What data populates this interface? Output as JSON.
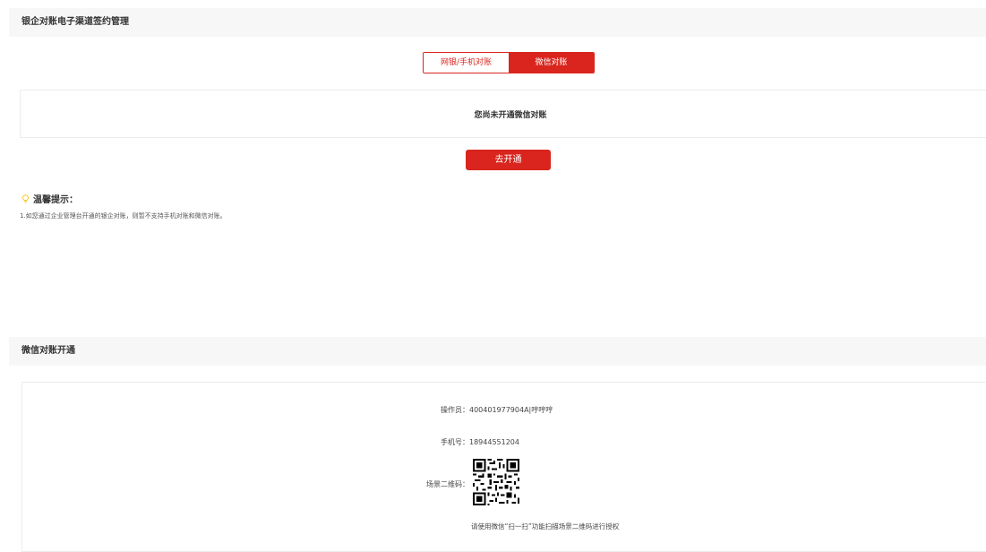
{
  "sections": {
    "signing_title": "银企对账电子渠道签约管理",
    "wechat_title": "微信对账开通"
  },
  "tabs": [
    {
      "label": "网银/手机对账",
      "active": false
    },
    {
      "label": "微信对账",
      "active": true
    }
  ],
  "notice": "您尚未开通微信对账",
  "open_button": "去开通",
  "tips": {
    "title": "温馨提示：",
    "line1": "1.如您通过企业管理台开通的银企对账，则暂不支持手机对账和微信对账。"
  },
  "wechat": {
    "operator_label": "操作员：",
    "operator_value": "400401977904A|哼哼哼",
    "phone_label": "手机号：",
    "phone_value": "18944551204",
    "qr_label": "场景二维码：",
    "qr_tip": "请使用微信“扫一扫”功能扫描场景二维码进行授权"
  },
  "colors": {
    "accent": "#d9251d",
    "header_bg": "#f7f7f7",
    "tip_icon": "#f5c518"
  },
  "icons": {
    "tip": "lightbulb-icon",
    "qr": "qr-code-icon"
  }
}
